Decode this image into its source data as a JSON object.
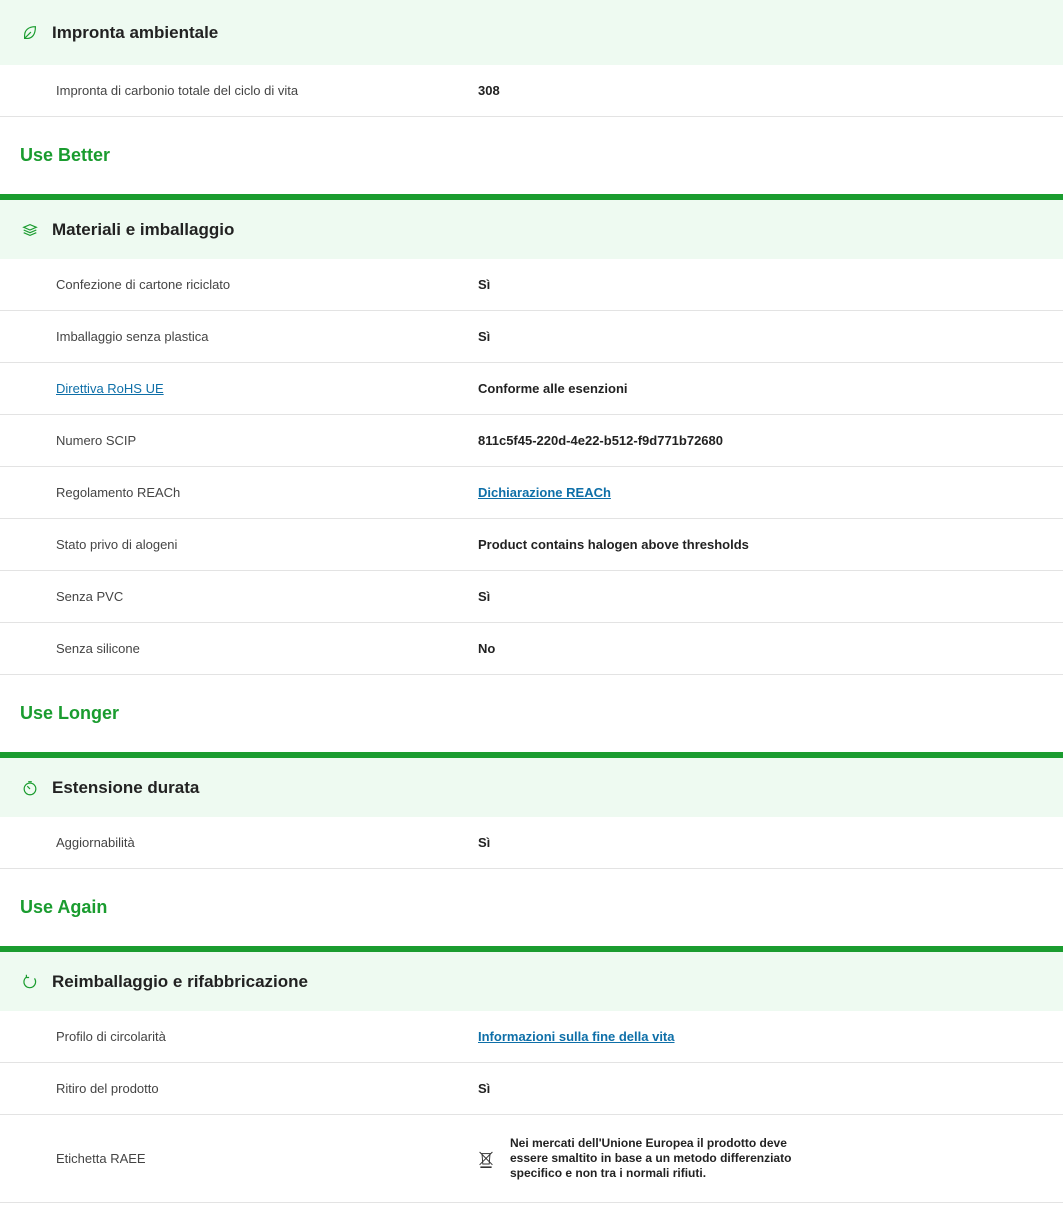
{
  "sections": {
    "footprint": {
      "title": "Impronta ambientale",
      "rows": [
        {
          "label": "Impronta di carbonio totale del ciclo di vita",
          "value": "308"
        }
      ]
    },
    "use_better": {
      "group": "Use Better",
      "title": "Materiali e imballaggio",
      "rows": [
        {
          "label": "Confezione di cartone riciclato",
          "value": "Sì"
        },
        {
          "label": "Imballaggio senza plastica",
          "value": "Sì"
        },
        {
          "label": "Direttiva RoHS UE",
          "value": "Conforme alle esenzioni"
        },
        {
          "label": "Numero SCIP",
          "value": "811c5f45-220d-4e22-b512-f9d771b72680"
        },
        {
          "label": "Regolamento REACh",
          "value": "Dichiarazione REACh"
        },
        {
          "label": "Stato privo di alogeni",
          "value": "Product contains halogen above thresholds"
        },
        {
          "label": "Senza PVC",
          "value": "Sì"
        },
        {
          "label": "Senza silicone",
          "value": "No"
        }
      ]
    },
    "use_longer": {
      "group": "Use Longer",
      "title": "Estensione durata",
      "rows": [
        {
          "label": "Aggiornabilità",
          "value": "Sì"
        }
      ]
    },
    "use_again": {
      "group": "Use Again",
      "title": "Reimballaggio e rifabbricazione",
      "rows": [
        {
          "label": "Profilo di circolarità",
          "value": "Informazioni sulla fine della vita"
        },
        {
          "label": "Ritiro del prodotto",
          "value": "Sì"
        },
        {
          "label": "Etichetta RAEE",
          "value": "Nei mercati dell'Unione Europea il prodotto deve essere smaltito in base a un metodo differenziato specifico e non tra i normali rifiuti."
        }
      ]
    }
  },
  "colors": {
    "accent": "#1a9c2f",
    "header_bg": "#eefaf1",
    "link": "#0e6fa8"
  }
}
